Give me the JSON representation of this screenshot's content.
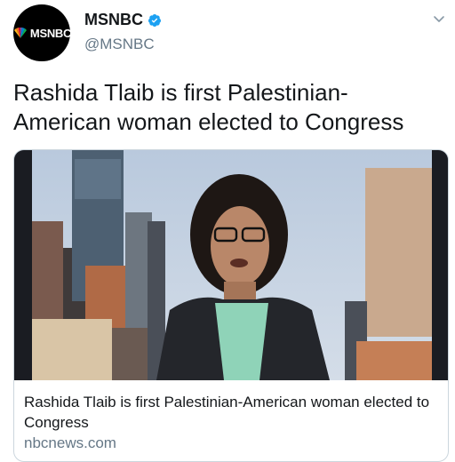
{
  "account": {
    "avatar_text": "MSNBC",
    "display_name": "MSNBC",
    "handle": "@MSNBC",
    "verified_color": "#1da1f2"
  },
  "tweet": {
    "text": "Rashida Tlaib is first Palestinian-American woman elected to Congress"
  },
  "card": {
    "title": "Rashida Tlaib is first Palestinian-American woman elected to Congress",
    "domain": "nbcnews.com",
    "border_color": "#ccd6dd"
  },
  "colors": {
    "text": "#14171a",
    "secondary": "#657786",
    "peacock": [
      "#ffb81c",
      "#f37021",
      "#cc004c",
      "#6460aa",
      "#0089d0",
      "#0db14b"
    ]
  },
  "icons": [
    "nbc-peacock-icon",
    "verified-badge-icon",
    "chevron-down-icon"
  ]
}
